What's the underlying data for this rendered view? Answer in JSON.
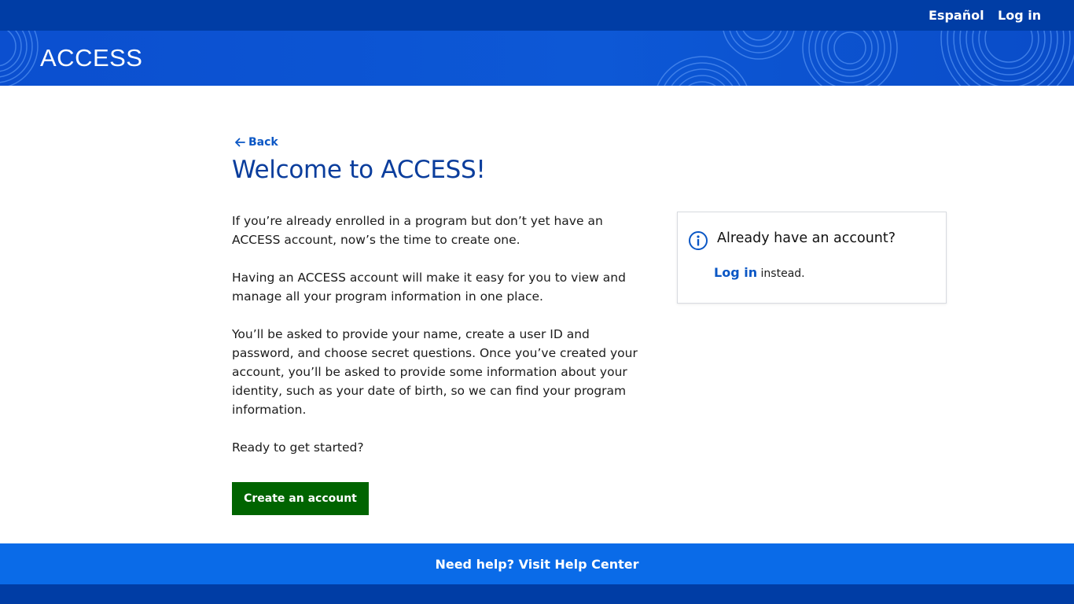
{
  "header": {
    "language_link": "Español",
    "login_link": "Log in",
    "brand": "ACCESS"
  },
  "main": {
    "back_label": "Back",
    "title": "Welcome to ACCESS!",
    "paragraphs": [
      "If you’re already enrolled in a program but don’t yet have an ACCESS account, now’s the time to create one.",
      "Having an ACCESS account will make it easy for you to view and manage all your program information in one place.",
      "You’ll be asked to provide your name, create a user ID and password, and choose secret questions. Once you’ve created your account, you’ll be asked to provide some information about your identity, such as your date of birth, so we can find your program information.",
      "Ready to get started?"
    ],
    "create_button": "Create an account"
  },
  "login_card": {
    "title": "Already have an account?",
    "link_label": "Log in",
    "suffix": " instead."
  },
  "footer": {
    "help_link": "Need help? Visit Help Center"
  },
  "colors": {
    "topbar": "#003da5",
    "banner": "#0d58d6",
    "title": "#0a3d9c",
    "link": "#0b57c5",
    "primary_button": "#006400",
    "help_bar": "#0a6be8"
  },
  "icons": {
    "back": "arrow-left-icon",
    "info": "info-circle-icon"
  }
}
